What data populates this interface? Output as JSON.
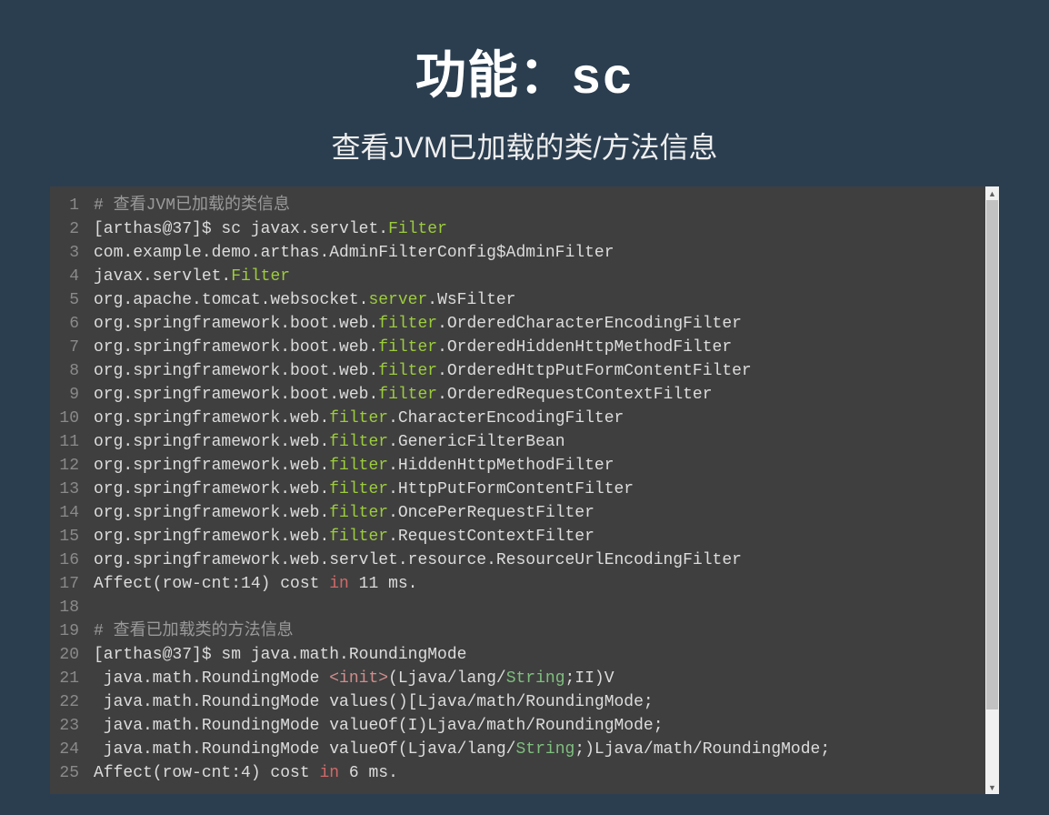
{
  "title_prefix": "功能：",
  "title_cmd": "sc",
  "subtitle": "查看JVM已加载的类/方法信息",
  "code_lines": [
    [
      {
        "t": "# 查看JVM已加载的类信息",
        "c": "tok-comment"
      }
    ],
    [
      {
        "t": "[arthas@37]$ sc javax.servlet."
      },
      {
        "t": "Filter",
        "c": "tok-green"
      }
    ],
    [
      {
        "t": "com.example.demo.arthas.AdminFilterConfig$AdminFilter"
      }
    ],
    [
      {
        "t": "javax.servlet."
      },
      {
        "t": "Filter",
        "c": "tok-green"
      }
    ],
    [
      {
        "t": "org.apache.tomcat.websocket."
      },
      {
        "t": "server",
        "c": "tok-green"
      },
      {
        "t": ".WsFilter"
      }
    ],
    [
      {
        "t": "org.springframework.boot.web."
      },
      {
        "t": "filter",
        "c": "tok-green"
      },
      {
        "t": ".OrderedCharacterEncodingFilter"
      }
    ],
    [
      {
        "t": "org.springframework.boot.web."
      },
      {
        "t": "filter",
        "c": "tok-green"
      },
      {
        "t": ".OrderedHiddenHttpMethodFilter"
      }
    ],
    [
      {
        "t": "org.springframework.boot.web."
      },
      {
        "t": "filter",
        "c": "tok-green"
      },
      {
        "t": ".OrderedHttpPutFormContentFilter"
      }
    ],
    [
      {
        "t": "org.springframework.boot.web."
      },
      {
        "t": "filter",
        "c": "tok-green"
      },
      {
        "t": ".OrderedRequestContextFilter"
      }
    ],
    [
      {
        "t": "org.springframework.web."
      },
      {
        "t": "filter",
        "c": "tok-green"
      },
      {
        "t": ".CharacterEncodingFilter"
      }
    ],
    [
      {
        "t": "org.springframework.web."
      },
      {
        "t": "filter",
        "c": "tok-green"
      },
      {
        "t": ".GenericFilterBean"
      }
    ],
    [
      {
        "t": "org.springframework.web."
      },
      {
        "t": "filter",
        "c": "tok-green"
      },
      {
        "t": ".HiddenHttpMethodFilter"
      }
    ],
    [
      {
        "t": "org.springframework.web."
      },
      {
        "t": "filter",
        "c": "tok-green"
      },
      {
        "t": ".HttpPutFormContentFilter"
      }
    ],
    [
      {
        "t": "org.springframework.web."
      },
      {
        "t": "filter",
        "c": "tok-green"
      },
      {
        "t": ".OncePerRequestFilter"
      }
    ],
    [
      {
        "t": "org.springframework.web."
      },
      {
        "t": "filter",
        "c": "tok-green"
      },
      {
        "t": ".RequestContextFilter"
      }
    ],
    [
      {
        "t": "org.springframework.web.servlet.resource.ResourceUrlEncodingFilter"
      }
    ],
    [
      {
        "t": "Affect(row-cnt:14) cost "
      },
      {
        "t": "in",
        "c": "tok-red"
      },
      {
        "t": " 11 ms."
      }
    ],
    [
      {
        "t": " "
      }
    ],
    [
      {
        "t": "# 查看已加载类的方法信息",
        "c": "tok-comment"
      }
    ],
    [
      {
        "t": "[arthas@37]$ sm java.math.RoundingMode"
      }
    ],
    [
      {
        "t": " java.math.RoundingMode "
      },
      {
        "t": "<init>",
        "c": "tok-salmon"
      },
      {
        "t": "(Ljava/lang/"
      },
      {
        "t": "String",
        "c": "tok-str"
      },
      {
        "t": ";II)V"
      }
    ],
    [
      {
        "t": " java.math.RoundingMode values()[Ljava/math/RoundingMode;"
      }
    ],
    [
      {
        "t": " java.math.RoundingMode valueOf(I)Ljava/math/RoundingMode;"
      }
    ],
    [
      {
        "t": " java.math.RoundingMode valueOf(Ljava/lang/"
      },
      {
        "t": "String",
        "c": "tok-str"
      },
      {
        "t": ";)Ljava/math/RoundingMode;"
      }
    ],
    [
      {
        "t": "Affect(row-cnt:4) cost "
      },
      {
        "t": "in",
        "c": "tok-red"
      },
      {
        "t": " 6 ms."
      }
    ]
  ]
}
